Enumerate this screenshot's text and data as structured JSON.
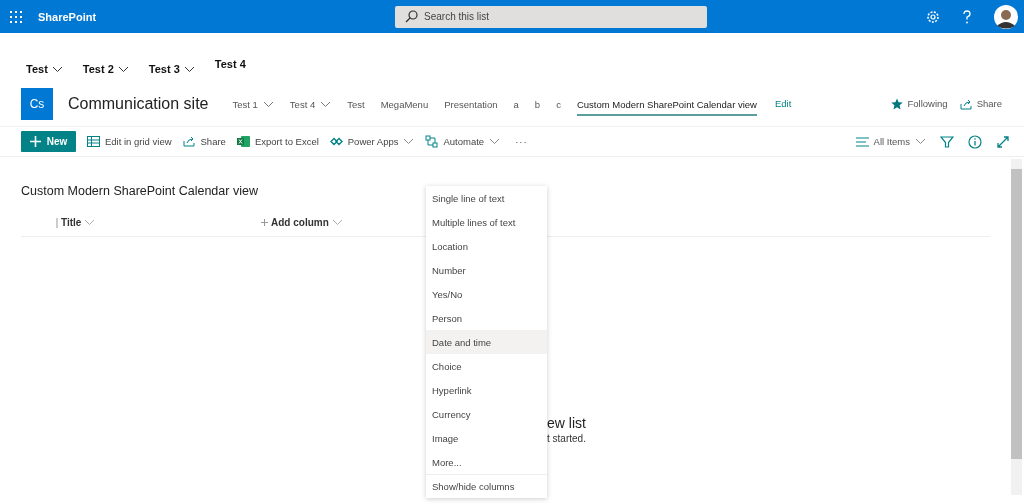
{
  "app_bar": {
    "app_name": "SharePoint",
    "search": {
      "placeholder": "Search this list"
    }
  },
  "hub_nav": [
    {
      "label": "Test",
      "has_menu": true
    },
    {
      "label": "Test 2",
      "has_menu": true
    },
    {
      "label": "Test 3",
      "has_menu": true
    },
    {
      "label": "Test 4",
      "has_menu": false
    }
  ],
  "site": {
    "logo": "Cs",
    "title": "Communication site",
    "nav": [
      {
        "label": "Test 1",
        "has_menu": true,
        "selected": false
      },
      {
        "label": "Test 4",
        "has_menu": true,
        "selected": false
      },
      {
        "label": "Test",
        "has_menu": false,
        "selected": false
      },
      {
        "label": "MegaMenu",
        "has_menu": false,
        "selected": false
      },
      {
        "label": "Presentation",
        "has_menu": false,
        "selected": false
      },
      {
        "label": "a",
        "has_menu": false,
        "selected": false
      },
      {
        "label": "b",
        "has_menu": false,
        "selected": false
      },
      {
        "label": "c",
        "has_menu": false,
        "selected": false
      },
      {
        "label": "Custom Modern SharePoint Calendar view",
        "has_menu": false,
        "selected": true
      }
    ],
    "edit_link": "Edit",
    "following": "Following",
    "share": "Share"
  },
  "command_bar": {
    "items": [
      {
        "label": "New",
        "kind": "primary"
      },
      {
        "label": "Edit in grid view",
        "kind": "command",
        "has_menu": false
      },
      {
        "label": "Share",
        "kind": "command",
        "has_menu": false
      },
      {
        "label": "Export to Excel",
        "kind": "command",
        "has_menu": false
      },
      {
        "label": "Power Apps",
        "kind": "command",
        "has_menu": true
      },
      {
        "label": "Automate",
        "kind": "command",
        "has_menu": true
      },
      {
        "label": "···",
        "kind": "more"
      }
    ],
    "view": "All Items"
  },
  "list": {
    "title": "Custom Modern SharePoint Calendar view",
    "columns": [
      {
        "label": "Title",
        "kind": "column"
      },
      {
        "label": "Add column",
        "kind": "add"
      }
    ],
    "empty_title": "ew list",
    "empty_text": "t started."
  },
  "column_menu": {
    "items": [
      {
        "label": "Single line of text",
        "highlighted": false
      },
      {
        "label": "Multiple lines of text",
        "highlighted": false
      },
      {
        "label": "Location",
        "highlighted": false
      },
      {
        "label": "Number",
        "highlighted": false
      },
      {
        "label": "Yes/No",
        "highlighted": false
      },
      {
        "label": "Person",
        "highlighted": false
      },
      {
        "label": "Date and time",
        "highlighted": true
      },
      {
        "label": "Choice",
        "highlighted": false
      },
      {
        "label": "Hyperlink",
        "highlighted": false
      },
      {
        "label": "Currency",
        "highlighted": false
      },
      {
        "label": "Image",
        "highlighted": false
      },
      {
        "label": "More...",
        "highlighted": false
      }
    ],
    "footer_item": "Show/hide columns"
  }
}
